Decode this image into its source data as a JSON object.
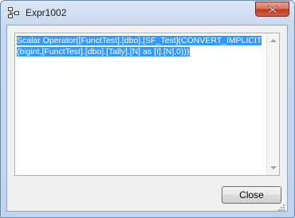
{
  "window": {
    "title": "Expr1002",
    "icon": "expression-tree-icon"
  },
  "titlebar": {
    "close_icon": "close-icon"
  },
  "textbox": {
    "value": "Scalar Operator([FunctTest].[dbo].[SF_Test](CONVERT_IMPLICIT(bigint,[FunctTest].[dbo].[Tally].[N] as [t].[N],0)))",
    "selected": true,
    "selection_color": "#3399ff"
  },
  "buttons": {
    "close_label": "Close"
  },
  "colors": {
    "title_close_red": "#c2391f",
    "frame": "#c9d9ee"
  }
}
